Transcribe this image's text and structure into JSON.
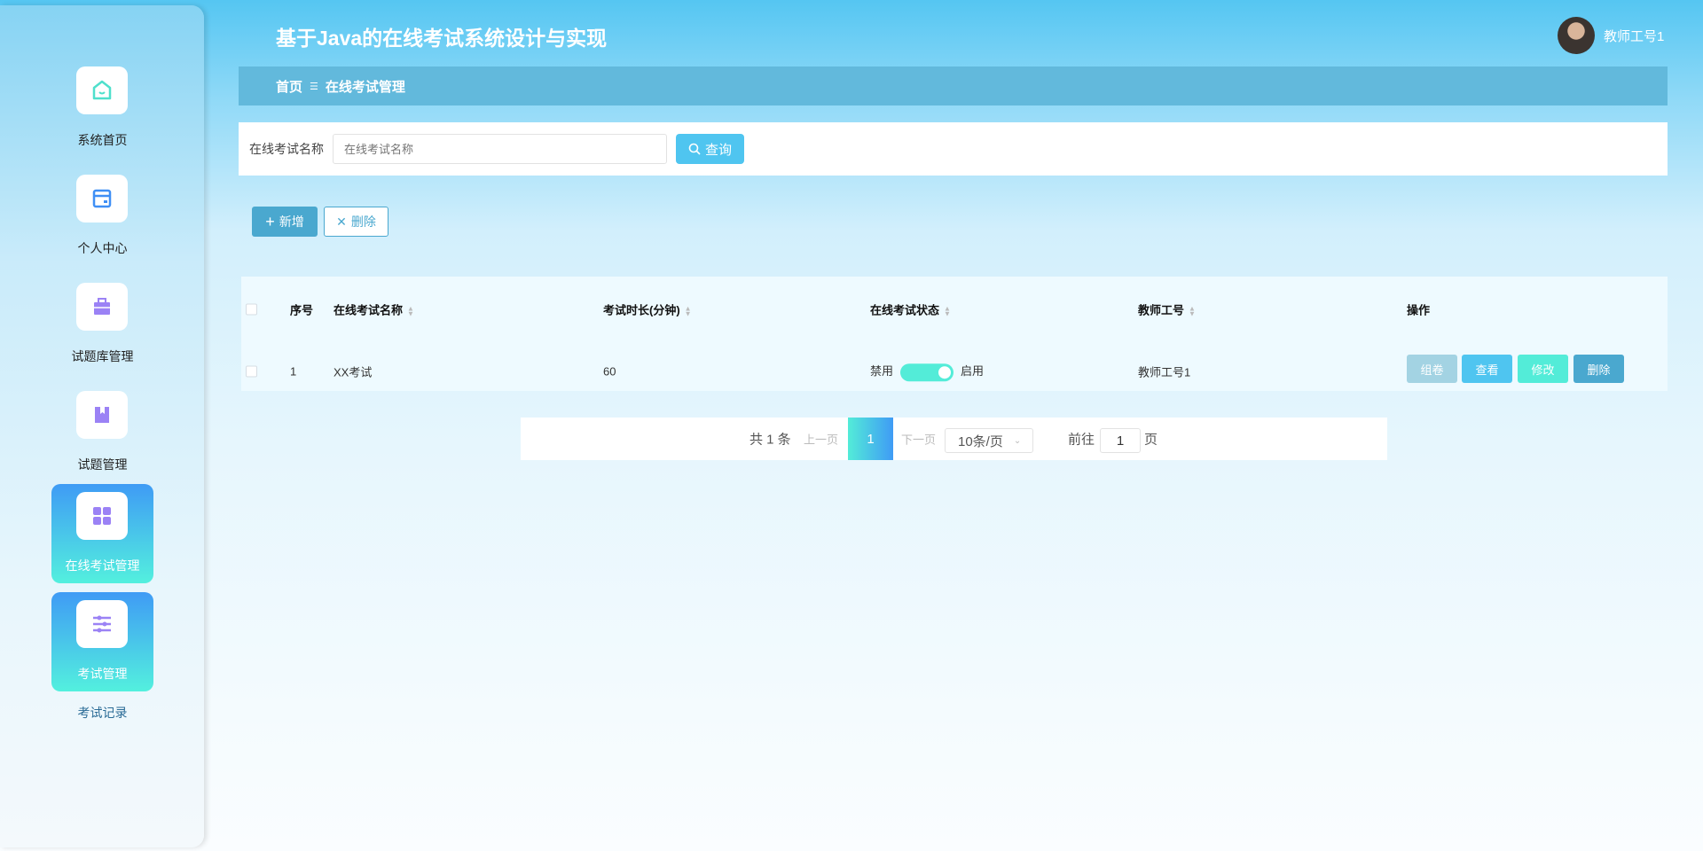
{
  "header": {
    "title": "基于Java的在线考试系统设计与实现",
    "user": "教师工号1"
  },
  "breadcrumb": {
    "home": "首页",
    "separator": "☰",
    "current": "在线考试管理"
  },
  "sidebar": {
    "items": [
      {
        "label": "系统首页",
        "icon": "home-icon"
      },
      {
        "label": "个人中心",
        "icon": "card-icon"
      },
      {
        "label": "试题库管理",
        "icon": "briefcase-icon"
      },
      {
        "label": "试题管理",
        "icon": "book-icon"
      },
      {
        "label": "在线考试管理",
        "icon": "grid-icon",
        "active": true
      },
      {
        "label": "考试管理",
        "icon": "sliders-icon",
        "active": true
      }
    ],
    "submenu": [
      "考试记录"
    ]
  },
  "search": {
    "label": "在线考试名称",
    "placeholder": "在线考试名称",
    "button": "查询"
  },
  "toolbar": {
    "add": "新增",
    "delete": "删除"
  },
  "table": {
    "headers": [
      "序号",
      "在线考试名称",
      "考试时长(分钟)",
      "在线考试状态",
      "教师工号",
      "操作"
    ],
    "rows": [
      {
        "index": "1",
        "name": "XX考试",
        "duration": "60",
        "status_off": "禁用",
        "status_on": "启用",
        "enabled": true,
        "teacher": "教师工号1"
      }
    ],
    "actions": [
      "组卷",
      "查看",
      "修改",
      "删除"
    ]
  },
  "pagination": {
    "total": "共 1 条",
    "prev": "上一页",
    "page": "1",
    "next": "下一页",
    "page_size": "10条/页",
    "goto": "前往",
    "goto_value": "1",
    "page_suffix": "页"
  },
  "colors": {
    "accent": "#4fc5f0",
    "breadcrumb": "#62b9dc",
    "toggle": "#53ecd8"
  }
}
